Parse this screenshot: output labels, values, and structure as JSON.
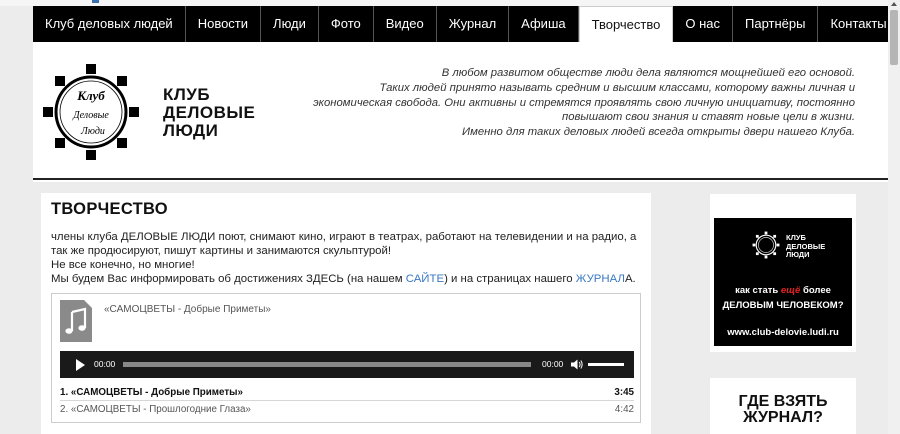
{
  "nav": {
    "items": [
      {
        "label": "Клуб деловых людей"
      },
      {
        "label": "Новости"
      },
      {
        "label": "Люди"
      },
      {
        "label": "Фото"
      },
      {
        "label": "Видео"
      },
      {
        "label": "Журнал"
      },
      {
        "label": "Афиша"
      },
      {
        "label": "Творчество",
        "active": true
      },
      {
        "label": "О нас"
      },
      {
        "label": "Партнёры"
      },
      {
        "label": "Контакты"
      }
    ]
  },
  "header": {
    "logo_text": "Клуб Деловые Люди",
    "title_lines": [
      "КЛУБ",
      "ДЕЛОВЫЕ",
      "ЛЮДИ"
    ],
    "slogan_lines": [
      "В любом развитом обществе люди дела являются мощнейшей его основой.",
      "Таких людей принято называть средним и высшим классами, которому важны личная и",
      "экономическая свобода. Они активны и стремятся проявлять свою личную инициативу, постоянно",
      "повышают свои знания и ставят новые цели в жизни.",
      "Именно для таких деловых людей всегда открыты двери нашего Клуба."
    ]
  },
  "main": {
    "heading": "ТВОРЧЕСТВО",
    "line1": "члены клуба ДЕЛОВЫЕ ЛЮДИ поют, снимают кино, играют в театрах, работают на телевидении и на радио, а",
    "line2": "так же продюсируют, пишут картины и занимаются скульптурой!",
    "line3": "Не все конечно, но многие!",
    "line4_before": "Мы будем Вас информировать об достижениях ЗДЕСЬ (на нашем ",
    "line4_link1": "САЙТЕ",
    "line4_middle": ") и на страницах нашего ",
    "line4_link2": "ЖУРНАЛ",
    "line4_after": "А."
  },
  "player": {
    "now_playing": "«САМОЦВЕТЫ - Добрые Приметы»",
    "current_time": "00:00",
    "duration": "00:00",
    "progress": 0,
    "volume": 1.0,
    "tracks": [
      {
        "num": "1.",
        "title": "«САМОЦВЕТЫ - Добрые Приметы»",
        "duration": "3:45",
        "active": true
      },
      {
        "num": "2.",
        "title": "«САМОЦВЕТЫ - Прошлогодние Глаза»",
        "duration": "4:42",
        "active": false
      }
    ]
  },
  "sidebar": {
    "ad": {
      "logo_lines": [
        "КЛУБ",
        "ДЕЛОВЫЕ",
        "ЛЮДИ"
      ],
      "line1_before": "как стать ",
      "line1_highlight": "ещё",
      "line1_after": " более",
      "line2": "ДЕЛОВЫМ ЧЕЛОВЕКОМ?",
      "url": "www.club-delovie.ludi.ru",
      "highlight_color": "#e32222"
    },
    "magazine_heading_lines": [
      "ГДЕ ВЗЯТЬ",
      "ЖУРНАЛ?"
    ]
  },
  "colors": {
    "nav_bg": "#000000",
    "link": "#3a78c2",
    "player_bg": "#1a1a1a"
  }
}
